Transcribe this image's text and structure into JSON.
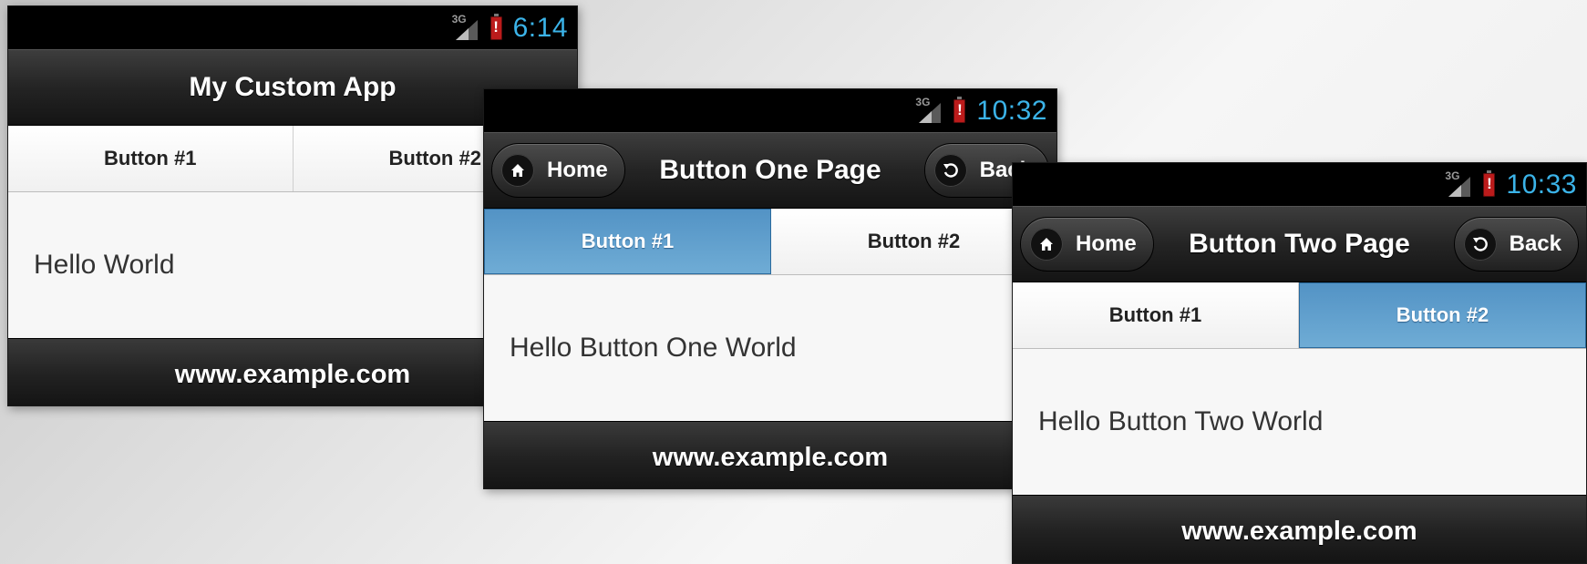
{
  "status_icons": {
    "network_label": "3G",
    "signal_icon": "signal-bars-icon",
    "battery_icon": "battery-alert-icon",
    "battery_alert": "!"
  },
  "screens": [
    {
      "time": "6:14",
      "title": "My Custom App",
      "nav": [
        "Button #1",
        "Button #2"
      ],
      "body_text": "Hello World",
      "footer": "www.example.com"
    },
    {
      "time": "10:32",
      "title": "Button One Page",
      "home_label": "Home",
      "back_label": "Back",
      "nav": [
        "Button #1",
        "Button #2"
      ],
      "active_nav": 0,
      "body_text": "Hello Button One World",
      "footer": "www.example.com"
    },
    {
      "time": "10:33",
      "title": "Button Two Page",
      "home_label": "Home",
      "back_label": "Back",
      "nav": [
        "Button #1",
        "Button #2"
      ],
      "active_nav": 1,
      "body_text": "Hello Button Two World",
      "footer": "www.example.com"
    }
  ],
  "colors": {
    "clock": "#3bb3e8",
    "active_tab": "#5393c5",
    "battery": "#bb1b1b"
  }
}
